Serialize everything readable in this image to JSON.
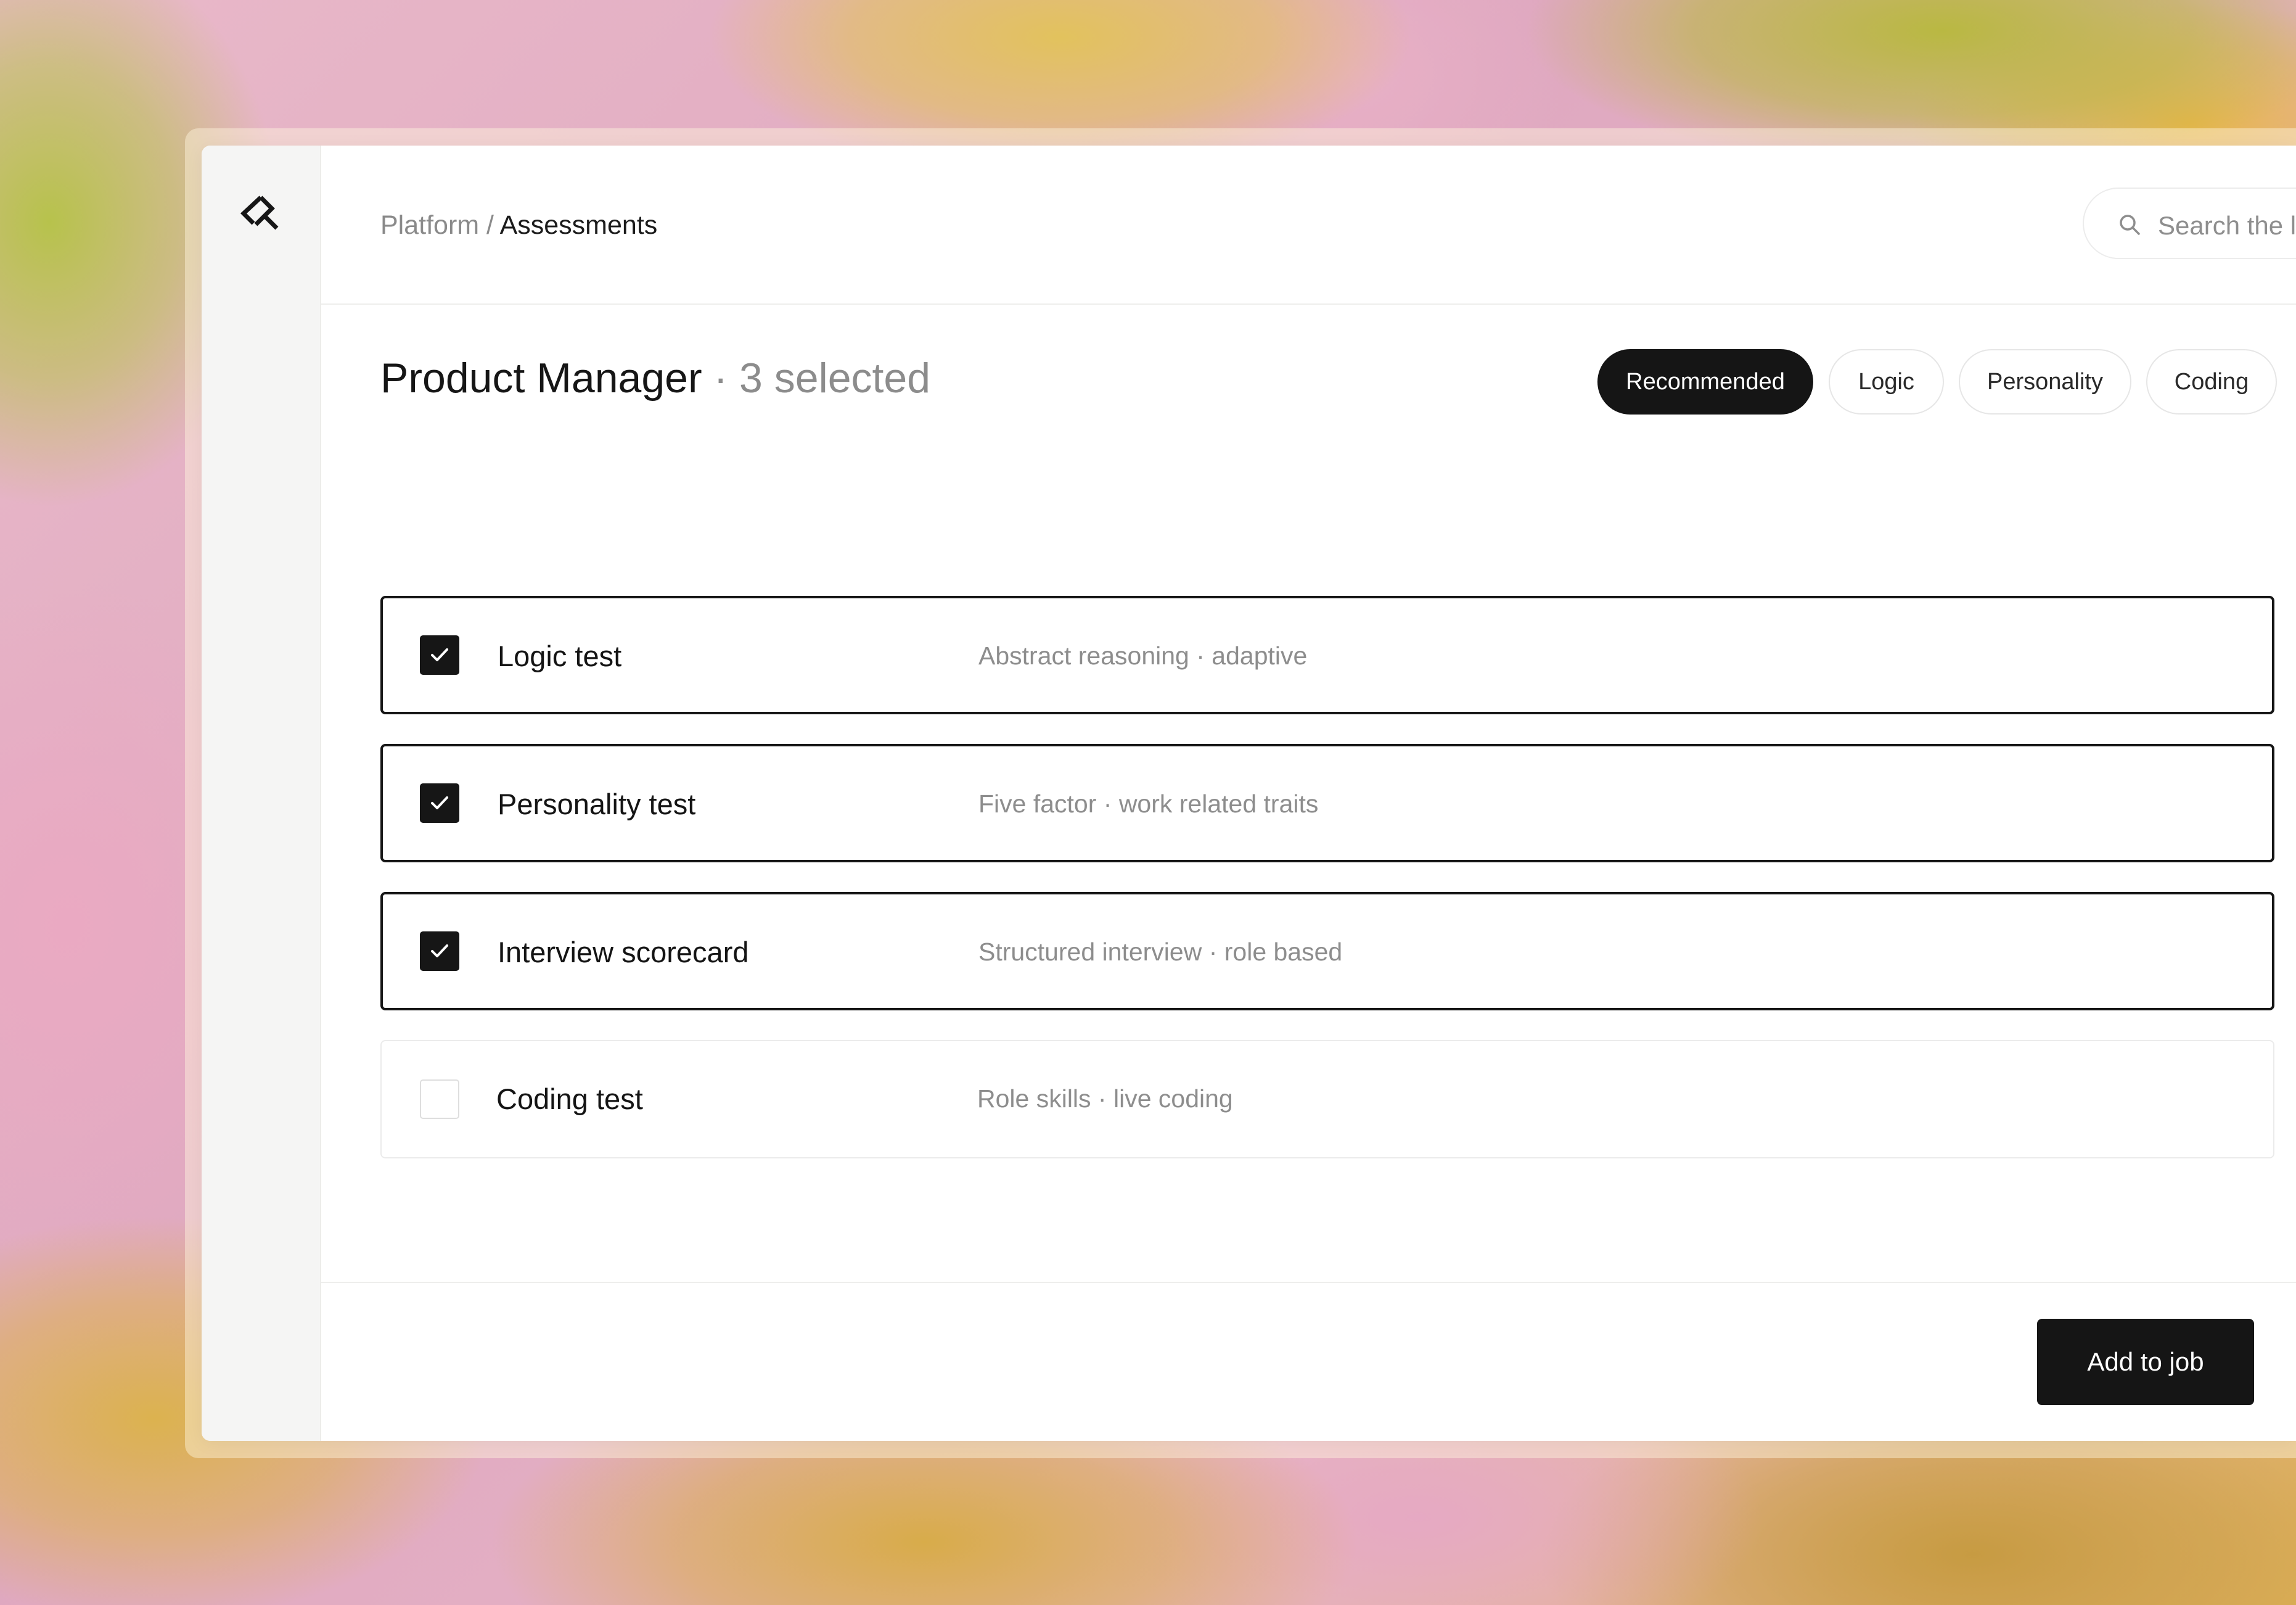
{
  "breadcrumb": {
    "parent": "Platform",
    "separator": " / ",
    "current": "Assessments"
  },
  "search": {
    "placeholder": "Search the library"
  },
  "page": {
    "title": "Product Manager",
    "selection_count": " · 3 selected"
  },
  "filters": [
    {
      "label": "Recommended",
      "active": true
    },
    {
      "label": "Logic",
      "active": false
    },
    {
      "label": "Personality",
      "active": false
    },
    {
      "label": "Coding",
      "active": false
    }
  ],
  "assessments": [
    {
      "title": "Logic test",
      "description": "Abstract reasoning · adaptive",
      "checked": true
    },
    {
      "title": "Personality test",
      "description": "Five factor · work related traits",
      "checked": true
    },
    {
      "title": "Interview scorecard",
      "description": "Structured interview · role based",
      "checked": true
    },
    {
      "title": "Coding test",
      "description": "Role skills · live coding",
      "checked": false
    }
  ],
  "footer": {
    "primary_action": "Add to job"
  },
  "icons": {
    "logo": "diamond-logo-icon",
    "search": "search-icon",
    "check": "check-icon"
  },
  "colors": {
    "accent": "#151515",
    "muted_text": "#8a8a8a",
    "sidebar_bg": "#f5f5f4"
  }
}
